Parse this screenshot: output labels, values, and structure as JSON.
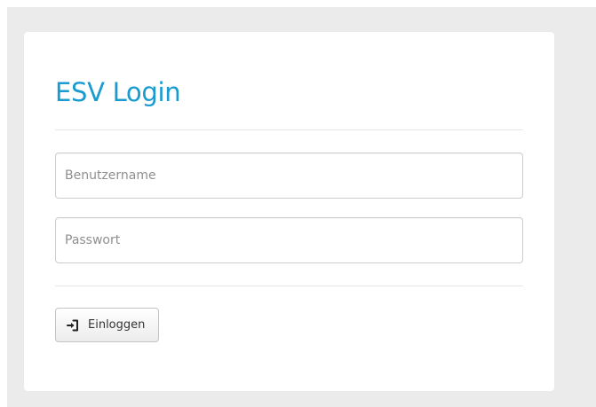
{
  "login": {
    "title": "ESV Login",
    "username_placeholder": "Benutzername",
    "username_value": "",
    "password_placeholder": "Passwort",
    "password_value": "",
    "submit_label": "Einloggen",
    "submit_icon": "login-icon"
  },
  "colors": {
    "title": "#199bd0",
    "page_background": "#ebebeb",
    "card_background": "#ffffff"
  }
}
